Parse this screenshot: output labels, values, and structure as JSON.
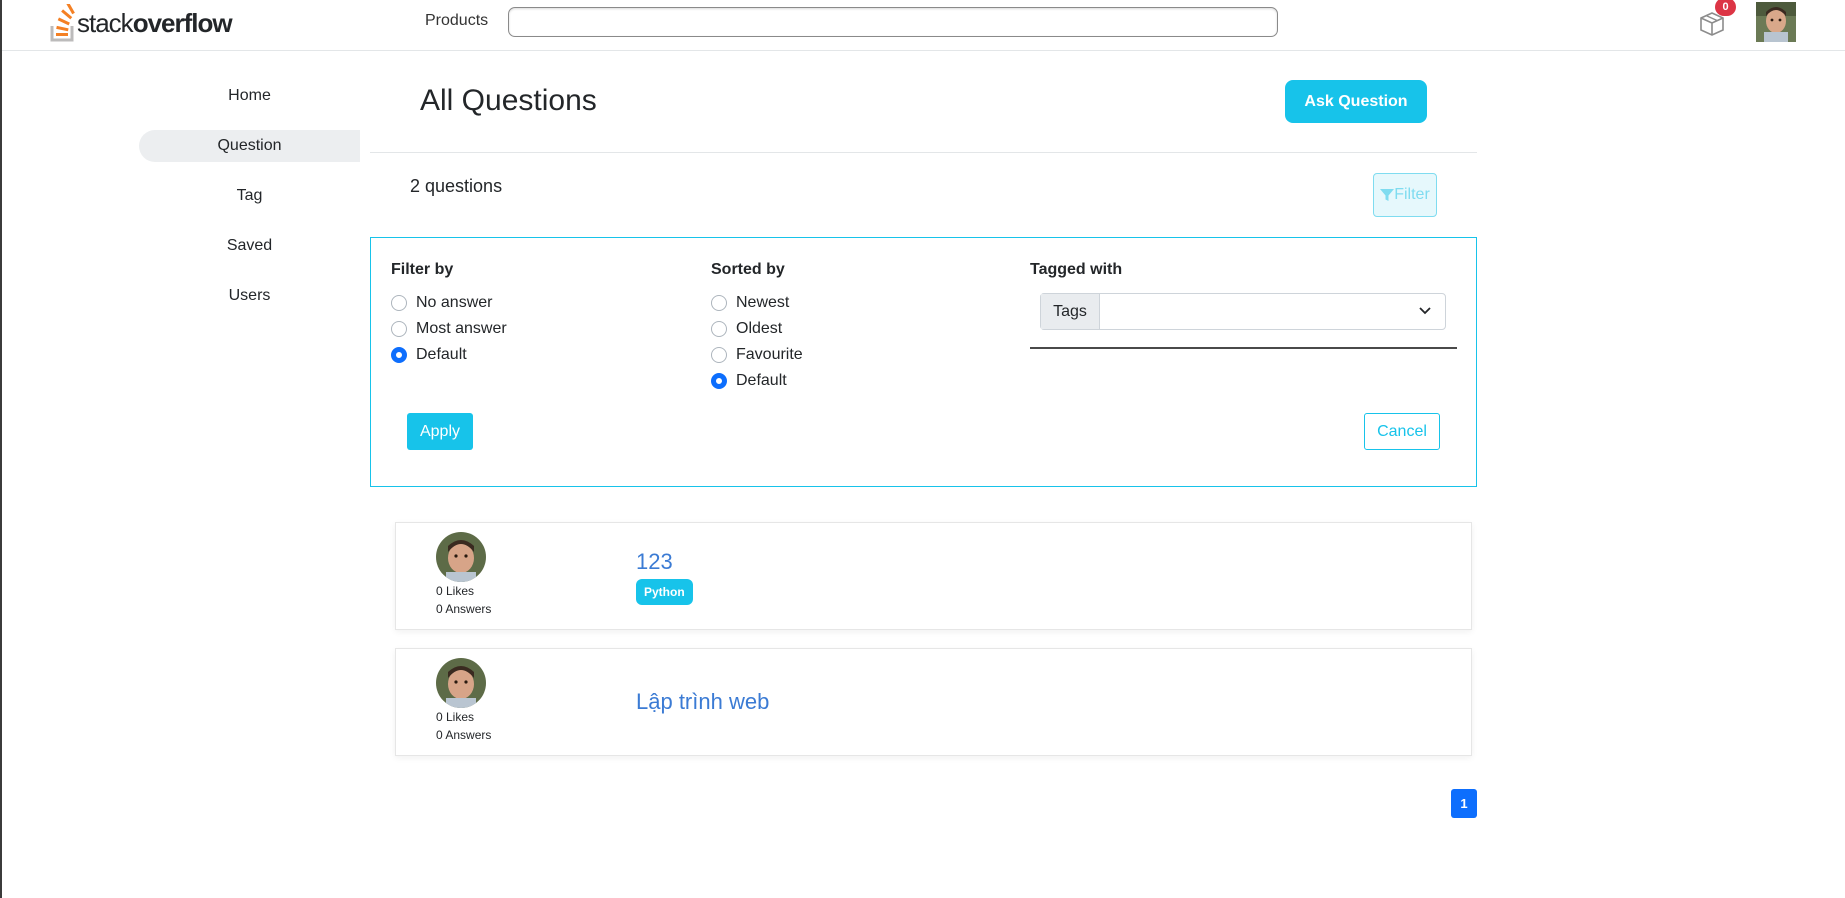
{
  "header": {
    "logo_text_light": "stack",
    "logo_text_bold": "overflow",
    "products_label": "Products",
    "search_placeholder": "",
    "notification_count": "0"
  },
  "sidebar": {
    "items": [
      {
        "label": "Home"
      },
      {
        "label": "Question"
      },
      {
        "label": "Tag"
      },
      {
        "label": "Saved"
      },
      {
        "label": "Users"
      }
    ],
    "active": "Question"
  },
  "main": {
    "title": "All Questions",
    "ask_button": "Ask Question",
    "question_count": "2 questions",
    "filter_button": "Filter"
  },
  "filter_panel": {
    "filter_by": {
      "title": "Filter by",
      "options": [
        "No answer",
        "Most answer",
        "Default"
      ],
      "selected": "Default"
    },
    "sorted_by": {
      "title": "Sorted by",
      "options": [
        "Newest",
        "Oldest",
        "Favourite",
        "Default"
      ],
      "selected": "Default"
    },
    "tagged_with": {
      "title": "Tagged with",
      "tags_label": "Tags",
      "value": ""
    },
    "apply_button": "Apply",
    "cancel_button": "Cancel"
  },
  "questions": [
    {
      "title": "123",
      "likes": "0 Likes",
      "answers": "0 Answers",
      "tag": "Python"
    },
    {
      "title": "Lập trình web",
      "likes": "0 Likes",
      "answers": "0 Answers",
      "tag": ""
    }
  ],
  "pagination": {
    "current": "1"
  },
  "colors": {
    "accent": "#17c3ea",
    "link": "#3b7bd4",
    "primary": "#0d6efd",
    "badge": "#dc3545",
    "logo_orange": "#f48024"
  },
  "icons": {
    "logo": "stackoverflow-logo-icon",
    "inbox": "box-icon",
    "filter": "filter-icon",
    "chevron": "chevron-down-icon"
  }
}
